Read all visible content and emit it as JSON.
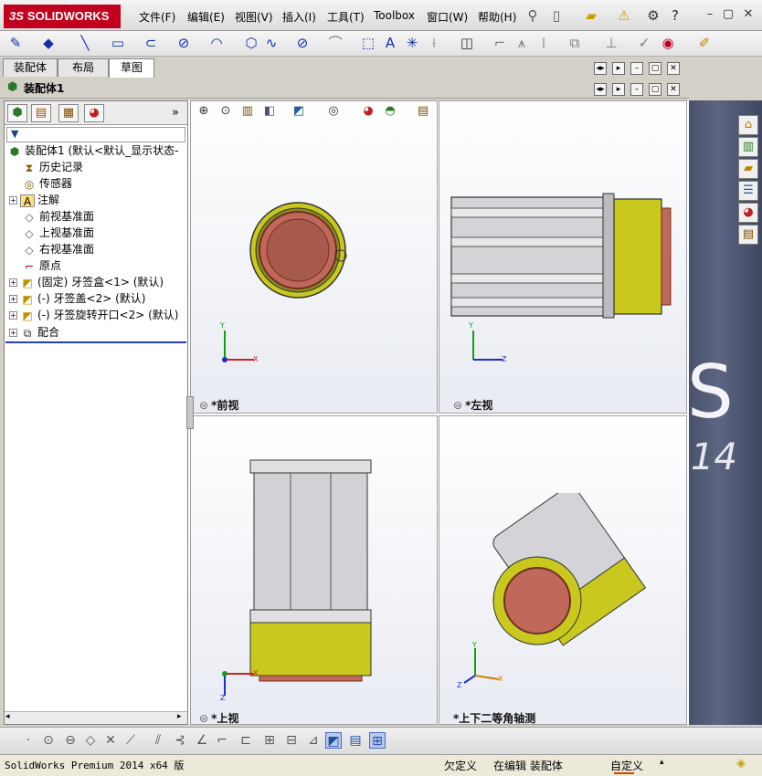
{
  "app": {
    "logo_mark": "3S",
    "logo_text": "SOLIDWORKS"
  },
  "menu": [
    "文件(F)",
    "编辑(E)",
    "视图(V)",
    "插入(I)",
    "工具(T)",
    "Toolbox",
    "窗口(W)",
    "帮助(H)"
  ],
  "cm_tabs": [
    "装配体",
    "布局",
    "草图"
  ],
  "active_tab": "草图",
  "document": {
    "title": "装配体1"
  },
  "feature_tree": {
    "filter_placeholder": "▼",
    "root": "装配体1  (默认<默认_显示状态-",
    "items": [
      {
        "label": "历史记录",
        "icon": "history-icon",
        "expand": ""
      },
      {
        "label": "传感器",
        "icon": "sensor-icon",
        "expand": ""
      },
      {
        "label": "注解",
        "icon": "annotation-icon",
        "expand": "+"
      },
      {
        "label": "前视基准面",
        "icon": "plane-icon",
        "expand": ""
      },
      {
        "label": "上视基准面",
        "icon": "plane-icon",
        "expand": ""
      },
      {
        "label": "右视基准面",
        "icon": "plane-icon",
        "expand": ""
      },
      {
        "label": "原点",
        "icon": "origin-icon",
        "expand": ""
      },
      {
        "label": "(固定) 牙签盒<1> (默认)",
        "icon": "part-icon",
        "expand": "+"
      },
      {
        "label": "(-) 牙签盖<2> (默认)",
        "icon": "part-icon",
        "expand": "+"
      },
      {
        "label": "(-) 牙签旋转开口<2> (默认)",
        "icon": "part-icon",
        "expand": "+"
      },
      {
        "label": "配合",
        "icon": "mates-icon",
        "expand": "+"
      }
    ]
  },
  "viewports": [
    {
      "label": "*前视",
      "axis1": "Y",
      "axis2": "X"
    },
    {
      "label": "*左视",
      "axis1": "Y",
      "axis2": "Z"
    },
    {
      "label": "*上视",
      "axis1": "Z",
      "axis2": "X"
    },
    {
      "label": "*上下二等角轴测",
      "axis1": "Y",
      "axis2": "Z",
      "axis3": "X"
    }
  ],
  "background": {
    "logo": "S",
    "version": "14"
  },
  "status": {
    "product": "SolidWorks Premium 2014 x64 版",
    "state1": "欠定义",
    "state2": "在编辑 装配体",
    "state3": "自定义",
    "arrow": "▴"
  },
  "colors": {
    "brand": "#c1001f",
    "body_gray": "#c8c8cc",
    "cap_yellow": "#c8c81e",
    "lid_red": "#c0685a"
  }
}
